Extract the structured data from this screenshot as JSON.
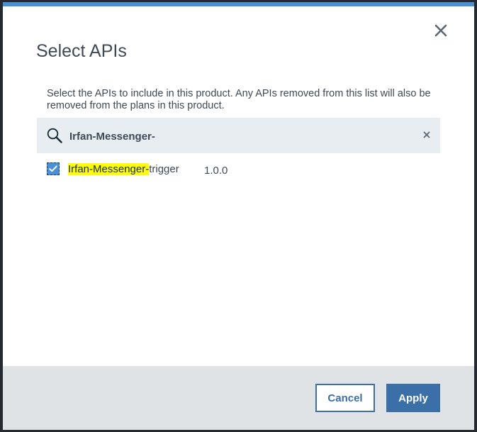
{
  "dialog": {
    "title": "Select APIs",
    "description": "Select the APIs to include in this product. Any APIs removed from this list will also be removed from the plans in this product.",
    "close_icon": "close-icon",
    "accent_color": "#4a90d9"
  },
  "search": {
    "value": "Irfan-Messenger-",
    "search_icon": "search-icon",
    "clear_icon": "clear-icon"
  },
  "api_list": [
    {
      "name_highlight": "Irfan-Messenger-",
      "name_rest": "trigger",
      "version": "1.0.0",
      "checked": true
    }
  ],
  "footer": {
    "cancel_label": "Cancel",
    "apply_label": "Apply",
    "primary_color": "#3b6fa8"
  }
}
